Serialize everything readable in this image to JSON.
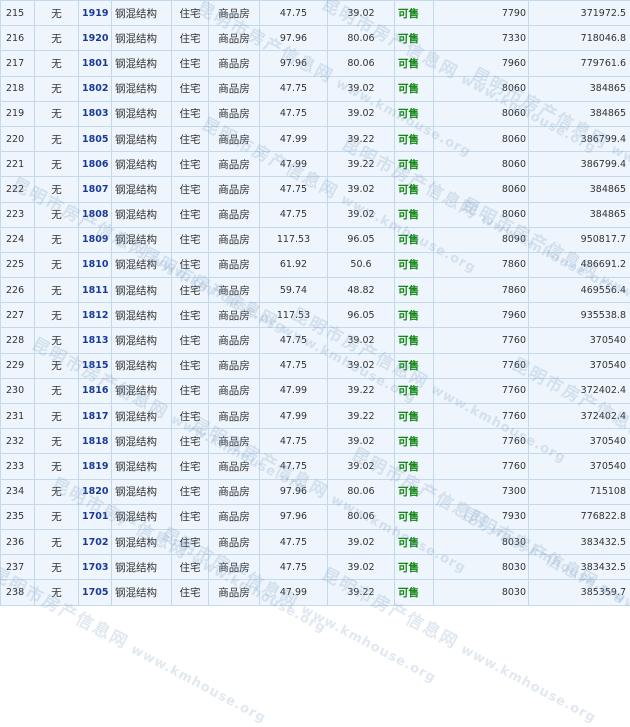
{
  "listing": {
    "rows": [
      {
        "idx": "215",
        "extra": "无",
        "room": "1919",
        "structure": "钢混结构",
        "use": "住宅",
        "type": "商品房",
        "area_build": "47.75",
        "area_inner": "39.02",
        "status": "可售",
        "unit_price": "7790",
        "total_price": "371972.5"
      },
      {
        "idx": "216",
        "extra": "无",
        "room": "1920",
        "structure": "钢混结构",
        "use": "住宅",
        "type": "商品房",
        "area_build": "97.96",
        "area_inner": "80.06",
        "status": "可售",
        "unit_price": "7330",
        "total_price": "718046.8"
      },
      {
        "idx": "217",
        "extra": "无",
        "room": "1801",
        "structure": "钢混结构",
        "use": "住宅",
        "type": "商品房",
        "area_build": "97.96",
        "area_inner": "80.06",
        "status": "可售",
        "unit_price": "7960",
        "total_price": "779761.6"
      },
      {
        "idx": "218",
        "extra": "无",
        "room": "1802",
        "structure": "钢混结构",
        "use": "住宅",
        "type": "商品房",
        "area_build": "47.75",
        "area_inner": "39.02",
        "status": "可售",
        "unit_price": "8060",
        "total_price": "384865"
      },
      {
        "idx": "219",
        "extra": "无",
        "room": "1803",
        "structure": "钢混结构",
        "use": "住宅",
        "type": "商品房",
        "area_build": "47.75",
        "area_inner": "39.02",
        "status": "可售",
        "unit_price": "8060",
        "total_price": "384865"
      },
      {
        "idx": "220",
        "extra": "无",
        "room": "1805",
        "structure": "钢混结构",
        "use": "住宅",
        "type": "商品房",
        "area_build": "47.99",
        "area_inner": "39.22",
        "status": "可售",
        "unit_price": "8060",
        "total_price": "386799.4"
      },
      {
        "idx": "221",
        "extra": "无",
        "room": "1806",
        "structure": "钢混结构",
        "use": "住宅",
        "type": "商品房",
        "area_build": "47.99",
        "area_inner": "39.22",
        "status": "可售",
        "unit_price": "8060",
        "total_price": "386799.4"
      },
      {
        "idx": "222",
        "extra": "无",
        "room": "1807",
        "structure": "钢混结构",
        "use": "住宅",
        "type": "商品房",
        "area_build": "47.75",
        "area_inner": "39.02",
        "status": "可售",
        "unit_price": "8060",
        "total_price": "384865"
      },
      {
        "idx": "223",
        "extra": "无",
        "room": "1808",
        "structure": "钢混结构",
        "use": "住宅",
        "type": "商品房",
        "area_build": "47.75",
        "area_inner": "39.02",
        "status": "可售",
        "unit_price": "8060",
        "total_price": "384865"
      },
      {
        "idx": "224",
        "extra": "无",
        "room": "1809",
        "structure": "钢混结构",
        "use": "住宅",
        "type": "商品房",
        "area_build": "117.53",
        "area_inner": "96.05",
        "status": "可售",
        "unit_price": "8090",
        "total_price": "950817.7"
      },
      {
        "idx": "225",
        "extra": "无",
        "room": "1810",
        "structure": "钢混结构",
        "use": "住宅",
        "type": "商品房",
        "area_build": "61.92",
        "area_inner": "50.6",
        "status": "可售",
        "unit_price": "7860",
        "total_price": "486691.2"
      },
      {
        "idx": "226",
        "extra": "无",
        "room": "1811",
        "structure": "钢混结构",
        "use": "住宅",
        "type": "商品房",
        "area_build": "59.74",
        "area_inner": "48.82",
        "status": "可售",
        "unit_price": "7860",
        "total_price": "469556.4"
      },
      {
        "idx": "227",
        "extra": "无",
        "room": "1812",
        "structure": "钢混结构",
        "use": "住宅",
        "type": "商品房",
        "area_build": "117.53",
        "area_inner": "96.05",
        "status": "可售",
        "unit_price": "7960",
        "total_price": "935538.8"
      },
      {
        "idx": "228",
        "extra": "无",
        "room": "1813",
        "structure": "钢混结构",
        "use": "住宅",
        "type": "商品房",
        "area_build": "47.75",
        "area_inner": "39.02",
        "status": "可售",
        "unit_price": "7760",
        "total_price": "370540"
      },
      {
        "idx": "229",
        "extra": "无",
        "room": "1815",
        "structure": "钢混结构",
        "use": "住宅",
        "type": "商品房",
        "area_build": "47.75",
        "area_inner": "39.02",
        "status": "可售",
        "unit_price": "7760",
        "total_price": "370540"
      },
      {
        "idx": "230",
        "extra": "无",
        "room": "1816",
        "structure": "钢混结构",
        "use": "住宅",
        "type": "商品房",
        "area_build": "47.99",
        "area_inner": "39.22",
        "status": "可售",
        "unit_price": "7760",
        "total_price": "372402.4"
      },
      {
        "idx": "231",
        "extra": "无",
        "room": "1817",
        "structure": "钢混结构",
        "use": "住宅",
        "type": "商品房",
        "area_build": "47.99",
        "area_inner": "39.22",
        "status": "可售",
        "unit_price": "7760",
        "total_price": "372402.4"
      },
      {
        "idx": "232",
        "extra": "无",
        "room": "1818",
        "structure": "钢混结构",
        "use": "住宅",
        "type": "商品房",
        "area_build": "47.75",
        "area_inner": "39.02",
        "status": "可售",
        "unit_price": "7760",
        "total_price": "370540"
      },
      {
        "idx": "233",
        "extra": "无",
        "room": "1819",
        "structure": "钢混结构",
        "use": "住宅",
        "type": "商品房",
        "area_build": "47.75",
        "area_inner": "39.02",
        "status": "可售",
        "unit_price": "7760",
        "total_price": "370540"
      },
      {
        "idx": "234",
        "extra": "无",
        "room": "1820",
        "structure": "钢混结构",
        "use": "住宅",
        "type": "商品房",
        "area_build": "97.96",
        "area_inner": "80.06",
        "status": "可售",
        "unit_price": "7300",
        "total_price": "715108"
      },
      {
        "idx": "235",
        "extra": "无",
        "room": "1701",
        "structure": "钢混结构",
        "use": "住宅",
        "type": "商品房",
        "area_build": "97.96",
        "area_inner": "80.06",
        "status": "可售",
        "unit_price": "7930",
        "total_price": "776822.8"
      },
      {
        "idx": "236",
        "extra": "无",
        "room": "1702",
        "structure": "钢混结构",
        "use": "住宅",
        "type": "商品房",
        "area_build": "47.75",
        "area_inner": "39.02",
        "status": "可售",
        "unit_price": "8030",
        "total_price": "383432.5"
      },
      {
        "idx": "237",
        "extra": "无",
        "room": "1703",
        "structure": "钢混结构",
        "use": "住宅",
        "type": "商品房",
        "area_build": "47.75",
        "area_inner": "39.02",
        "status": "可售",
        "unit_price": "8030",
        "total_price": "383432.5"
      },
      {
        "idx": "238",
        "extra": "无",
        "room": "1705",
        "structure": "钢混结构",
        "use": "住宅",
        "type": "商品房",
        "area_build": "47.99",
        "area_inner": "39.22",
        "status": "可售",
        "unit_price": "8030",
        "total_price": "385359.7"
      }
    ]
  },
  "watermark": {
    "text_cn": "昆明市房产信息网",
    "text_en": "www.kmhouse.org"
  },
  "colors": {
    "status_green": "#118811",
    "room_link_blue": "#1a3a9a",
    "cell_bg": "#eef5fc",
    "grid_line": "#c4d8ec"
  }
}
